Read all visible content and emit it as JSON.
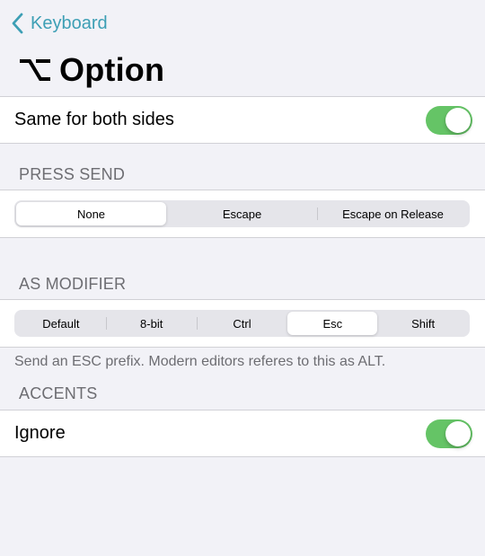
{
  "nav": {
    "back_label": "Keyboard"
  },
  "title": {
    "glyph": "option-key-icon",
    "text": "Option"
  },
  "rows": {
    "same_for_both_sides": {
      "label": "Same for both sides",
      "on": true
    }
  },
  "press_send": {
    "header": "PRESS SEND",
    "options": [
      "None",
      "Escape",
      "Escape on Release"
    ],
    "selected": "None"
  },
  "as_modifier": {
    "header": "AS MODIFIER",
    "options": [
      "Default",
      "8-bit",
      "Ctrl",
      "Esc",
      "Shift"
    ],
    "selected": "Esc",
    "footer": "Send an ESC prefix. Modern editors referes to this as ALT."
  },
  "accents": {
    "header": "ACCENTS",
    "ignore": {
      "label": "Ignore",
      "on": true
    }
  },
  "colors": {
    "accent": "#3d9fb5",
    "toggle_on": "#65c466",
    "background": "#f2f2f7"
  }
}
